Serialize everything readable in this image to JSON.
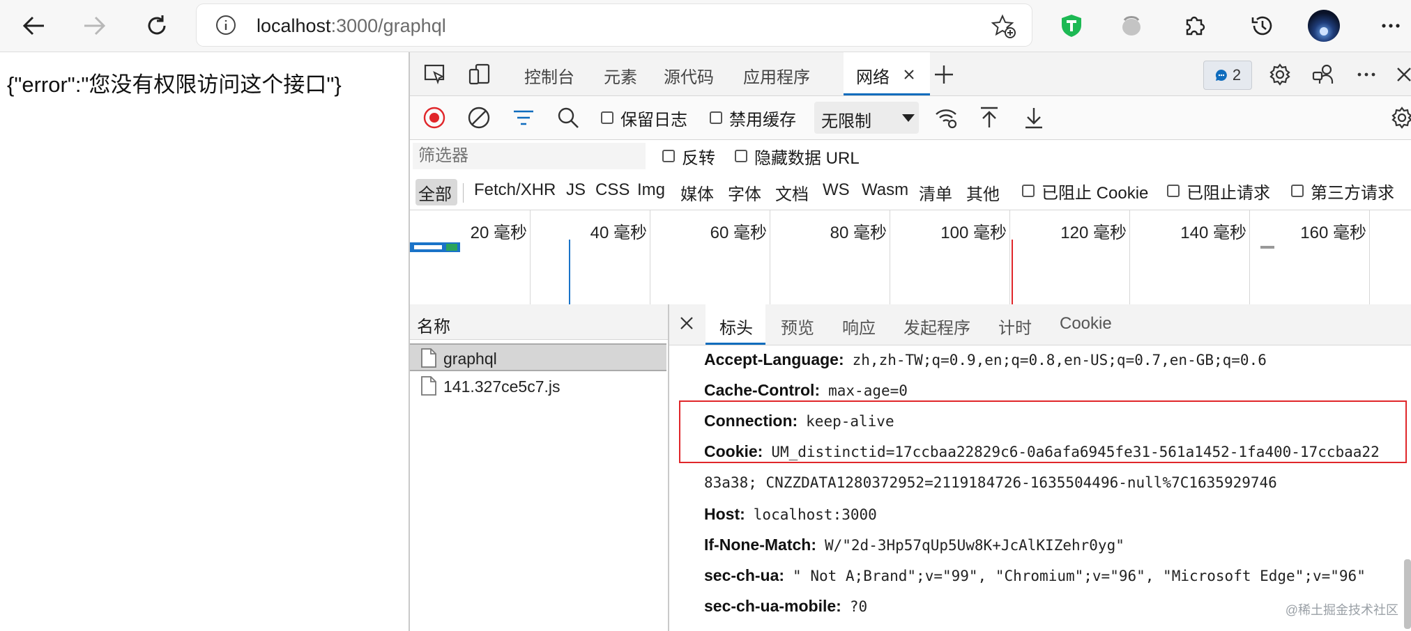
{
  "browser": {
    "url_host": "localhost",
    "url_rest": ":3000/graphql"
  },
  "page": {
    "body_text": "{\"error\":\"您没有权限访问这个接口\"}"
  },
  "devtools": {
    "tabs": [
      "控制台",
      "元素",
      "源代码",
      "应用程序",
      "网络"
    ],
    "active_tab": "网络",
    "issues_count": "2",
    "network_toolbar": {
      "preserve_log": "保留日志",
      "disable_cache": "禁用缓存",
      "throttling": "无限制"
    },
    "filter": {
      "placeholder": "筛选器",
      "invert": "反转",
      "hide_data_urls": "隐藏数据 URL"
    },
    "types": [
      "全部",
      "Fetch/XHR",
      "JS",
      "CSS",
      "Img",
      "媒体",
      "字体",
      "文档",
      "WS",
      "Wasm",
      "清单",
      "其他"
    ],
    "blocked": {
      "cookies": "已阻止 Cookie",
      "requests": "已阻止请求",
      "third_party": "第三方请求"
    },
    "timeline_labels": [
      "20 毫秒",
      "40 毫秒",
      "60 毫秒",
      "80 毫秒",
      "100 毫秒",
      "120 毫秒",
      "140 毫秒",
      "160 毫秒"
    ],
    "name_header": "名称",
    "requests": [
      "graphql",
      "141.327ce5c7.js"
    ],
    "detail_tabs": [
      "标头",
      "预览",
      "响应",
      "发起程序",
      "计时",
      "Cookie"
    ],
    "headers": [
      {
        "name": "Accept-Language:",
        "value": "zh,zh-TW;q=0.9,en;q=0.8,en-US;q=0.7,en-GB;q=0.6"
      },
      {
        "name": "Cache-Control:",
        "value": "max-age=0"
      },
      {
        "name": "Connection:",
        "value": "keep-alive"
      },
      {
        "name": "Cookie:",
        "value": "UM_distinctid=17ccbaa22829c6-0a6afa6945fe31-561a1452-1fa400-17ccbaa22",
        "value_cont": "83a38; CNZZDATA1280372952=2119184726-1635504496-null%7C1635929746"
      },
      {
        "name": "Host:",
        "value": "localhost:3000"
      },
      {
        "name": "If-None-Match:",
        "value": "W/\"2d-3Hp57qUp5Uw8K+JcAlKIZehr0yg\""
      },
      {
        "name": "sec-ch-ua:",
        "value": "\" Not A;Brand\";v=\"99\", \"Chromium\";v=\"96\", \"Microsoft Edge\";v=\"96\""
      },
      {
        "name": "sec-ch-ua-mobile:",
        "value": "?0"
      }
    ]
  },
  "watermark": "@稀土掘金技术社区",
  "colors": {
    "accent": "#0f6cbd",
    "record": "#e0262a",
    "highlight_box": "#e0262a"
  }
}
